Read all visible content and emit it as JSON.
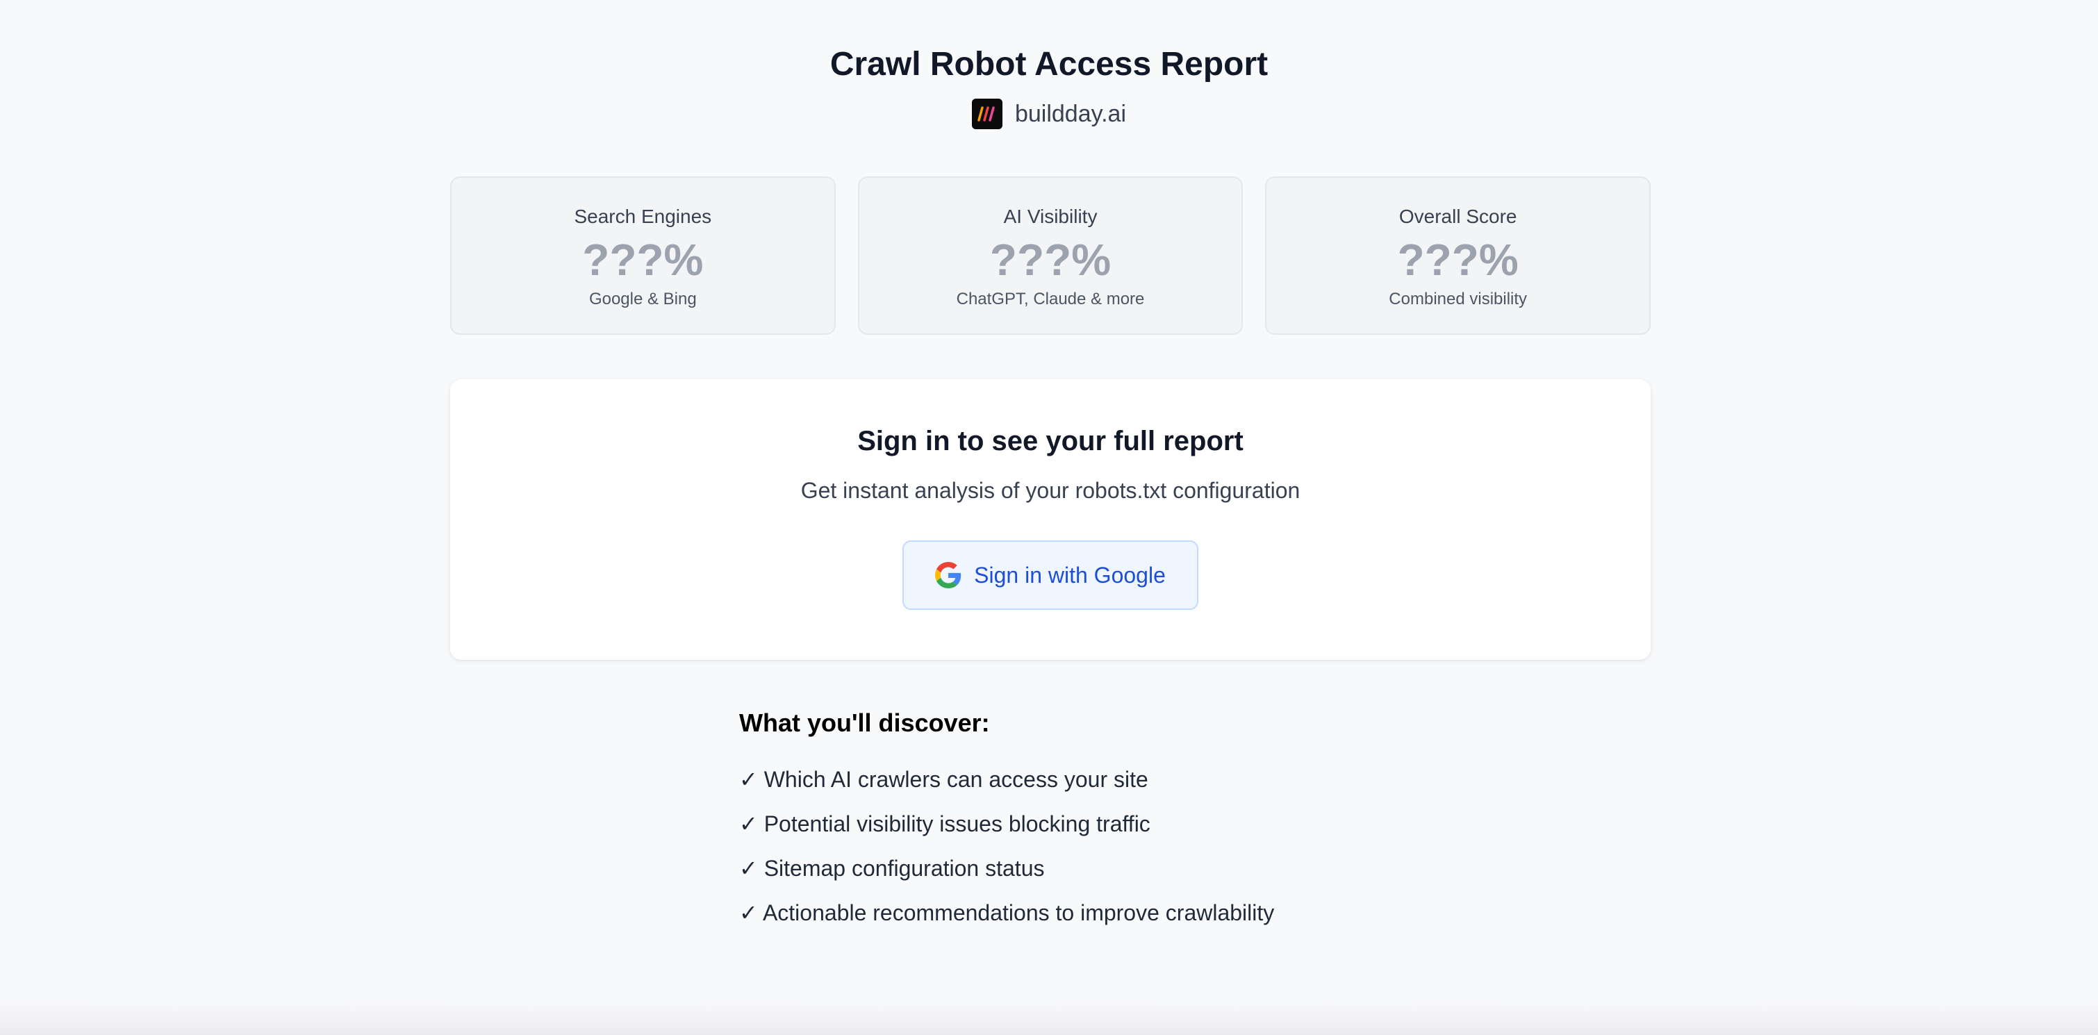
{
  "header": {
    "title": "Crawl Robot Access Report",
    "site_name": "buildday.ai",
    "site_logo_icon": "buildday-logo-icon"
  },
  "stats": [
    {
      "label": "Search Engines",
      "value": "???%",
      "sub": "Google & Bing"
    },
    {
      "label": "AI Visibility",
      "value": "???%",
      "sub": "ChatGPT, Claude & more"
    },
    {
      "label": "Overall Score",
      "value": "???%",
      "sub": "Combined visibility"
    }
  ],
  "signin": {
    "heading": "Sign in to see your full report",
    "subheading": "Get instant analysis of your robots.txt configuration",
    "button_label": "Sign in with Google",
    "button_icon": "google-icon"
  },
  "discover": {
    "title": "What you'll discover:",
    "items": [
      "✓ Which AI crawlers can access your site",
      "✓ Potential visibility issues blocking traffic",
      "✓ Sitemap configuration status",
      "✓ Actionable recommendations to improve crawlability"
    ]
  },
  "colors": {
    "background": "#f8f9fb",
    "card_background": "#f3f4f6",
    "placeholder_value": "#9ca3af",
    "button_background": "#eff6ff",
    "button_text": "#1d4ed8"
  }
}
